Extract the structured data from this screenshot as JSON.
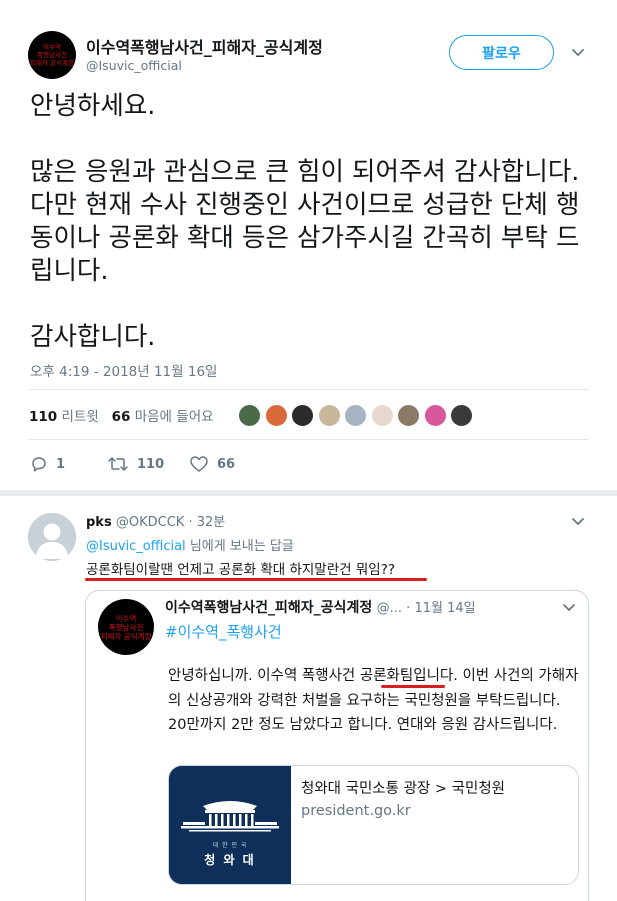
{
  "tweet": {
    "account_name": "이수역폭행남사건_피해자_공식계정",
    "handle": "@Isuvic_official",
    "follow_label": "팔로우",
    "avatar_lines": [
      "이수역",
      "폭행남사건",
      "피해자 공식계정"
    ],
    "text": "안녕하세요.\n\n많은 응원과 관심으로 큰 힘이 되어주셔 감사합니다. 다만 현재 수사 진행중인 사건이므로 성급한 단체 행동이나 공론화 확대 등은 삼가주시길 간곡히 부탁 드립니다.\n\n감사합니다.",
    "timestamp": "오후 4:19 - 2018년 11월 16일"
  },
  "stats": {
    "retweet_count": "110",
    "retweet_label": "리트윗",
    "like_count": "66",
    "like_label": "마음에 들어요",
    "liker_colors": [
      "#4b6a4a",
      "#d9683b",
      "#2b2b2b",
      "#c9b79c",
      "#a7b3c0",
      "#e8d7cc",
      "#8a7a66",
      "#d8579a",
      "#3a3a3a"
    ]
  },
  "actions": {
    "reply_count": "1",
    "retweet_count": "110",
    "like_count": "66"
  },
  "reply": {
    "name": "pks",
    "handle": "@OKDCCK",
    "time": "32분",
    "reply_to_handle": "@Isuvic_official",
    "reply_to_suffix": "님에게 보내는 답글",
    "text": "공론화팀이랄땐 언제고 공론화 확대 하지말란건 뭐임??"
  },
  "quote": {
    "name": "이수역폭행남사건_피해자_공식계정",
    "handle_time": "@... · 11월 14일",
    "hashtag": "#이수역_폭행사건",
    "text_before": "안녕하십니까. 이수역 폭행사건 ",
    "text_highlight": "공론화팀",
    "text_after": "입니다. 이번 사건의 가해자의 신상공개와 강력한 처벌을 요구하는 국민청원을 부탁드립니다. 20만까지 2만 정도 남았다고 합니다. 연대와 응원 감사드립니다.",
    "card": {
      "title": "청와대 국민소통 광장 > 국민청원",
      "domain": "president.go.kr",
      "image_caption_small": "대 한 민 국",
      "image_caption": "청 와 대"
    }
  },
  "colors": {
    "accent": "#1da1f2",
    "highlight_underline": "#d81e1e",
    "avatar_text": "#d21414"
  }
}
